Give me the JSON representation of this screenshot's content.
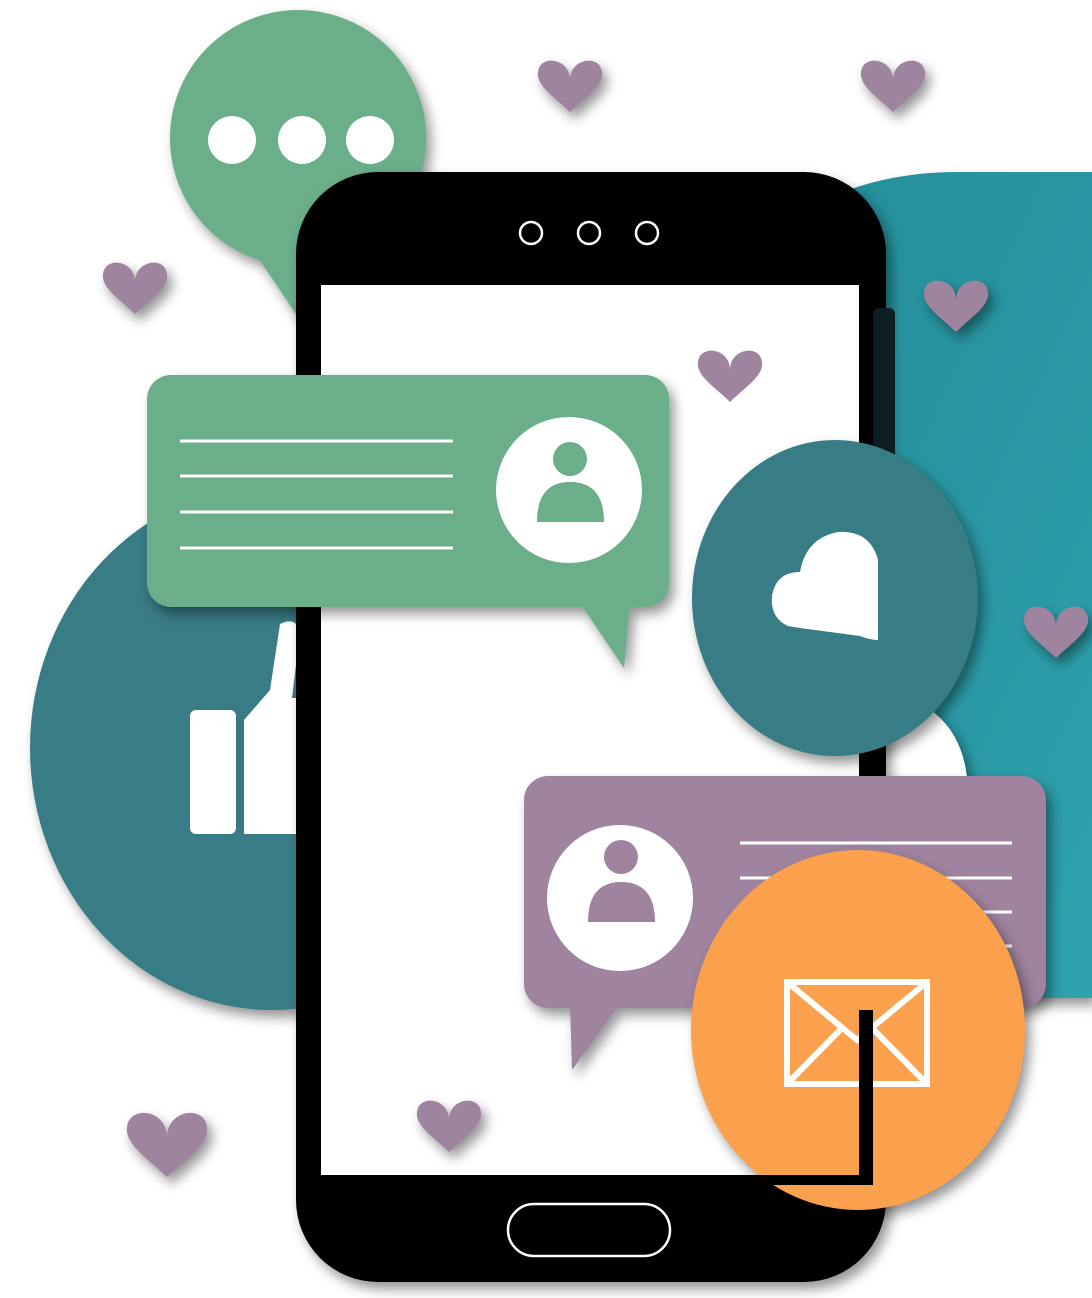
{
  "illustration": {
    "subject": "smartphone-social-media-notifications",
    "icons": [
      "ellipsis-icon",
      "thumbs-up-icon",
      "user-icon",
      "heart-icon",
      "cloud-icon",
      "envelope-icon"
    ],
    "speaker_dots": 3,
    "heart_count": 9
  },
  "colors": {
    "background": "#ffffff",
    "teal_panel": "#2a98a4",
    "teal_dark": "#387c85",
    "green": "#6aae8a",
    "purple": "#a0849f",
    "heart": "#9e849f",
    "orange": "#fba14d",
    "phone": "#000000",
    "screen": "#ffffff"
  }
}
